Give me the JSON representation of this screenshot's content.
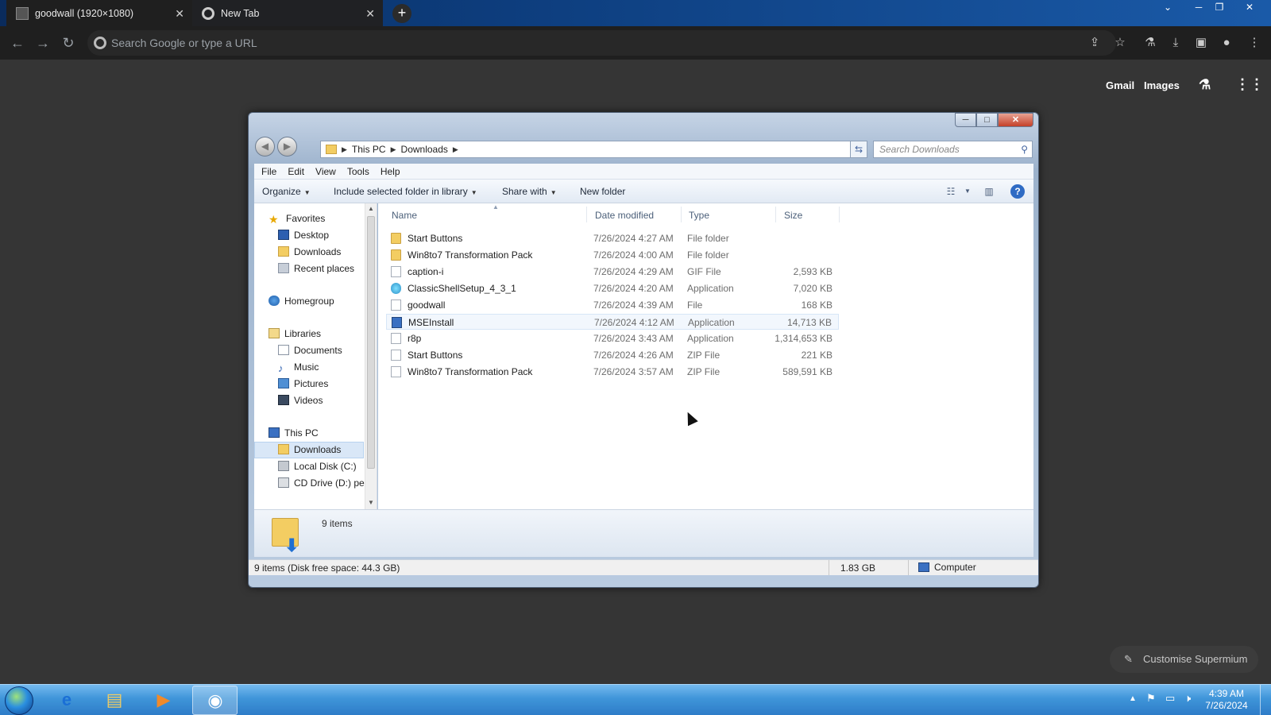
{
  "browser": {
    "tabs": [
      {
        "title": "goodwall (1920×1080)",
        "active": true
      },
      {
        "title": "New Tab",
        "active": false
      }
    ],
    "new_tab_label": "+",
    "omnibox_placeholder": "Search Google or type a URL",
    "ntp": {
      "gmail": "Gmail",
      "images": "Images",
      "customise": "Customise Supermium"
    }
  },
  "explorer": {
    "breadcrumb": [
      "This PC",
      "Downloads"
    ],
    "search_placeholder": "Search Downloads",
    "menu": [
      "File",
      "Edit",
      "View",
      "Tools",
      "Help"
    ],
    "commands": {
      "organize": "Organize",
      "include_library": "Include selected folder in library",
      "share_with": "Share with",
      "new_folder": "New folder"
    },
    "nav": {
      "favorites": "Favorites",
      "desktop": "Desktop",
      "downloads": "Downloads",
      "recent": "Recent places",
      "homegroup": "Homegroup",
      "libraries": "Libraries",
      "documents": "Documents",
      "music": "Music",
      "pictures": "Pictures",
      "videos": "Videos",
      "this_pc": "This PC",
      "pc_downloads": "Downloads",
      "local_disk": "Local Disk (C:)",
      "cd_drive": "CD Drive (D:) per"
    },
    "columns": {
      "name": "Name",
      "date": "Date modified",
      "type": "Type",
      "size": "Size"
    },
    "files": [
      {
        "name": "Start Buttons",
        "date": "7/26/2024 4:27 AM",
        "type": "File folder",
        "size": "",
        "icon": "folder-icon"
      },
      {
        "name": "Win8to7 Transformation Pack",
        "date": "7/26/2024 4:00 AM",
        "type": "File folder",
        "size": "",
        "icon": "folder-icon"
      },
      {
        "name": "caption-i",
        "date": "7/26/2024 4:29 AM",
        "type": "GIF File",
        "size": "2,593 KB",
        "icon": "file-icon"
      },
      {
        "name": "ClassicShellSetup_4_3_1",
        "date": "7/26/2024 4:20 AM",
        "type": "Application",
        "size": "7,020 KB",
        "icon": "app-icon"
      },
      {
        "name": "goodwall",
        "date": "7/26/2024 4:39 AM",
        "type": "File",
        "size": "168 KB",
        "icon": "file-icon"
      },
      {
        "name": "MSEInstall",
        "date": "7/26/2024 4:12 AM",
        "type": "Application",
        "size": "14,713 KB",
        "icon": "installer-icon"
      },
      {
        "name": "r8p",
        "date": "7/26/2024 3:43 AM",
        "type": "Application",
        "size": "1,314,653 KB",
        "icon": "file-icon"
      },
      {
        "name": "Start Buttons",
        "date": "7/26/2024 4:26 AM",
        "type": "ZIP File",
        "size": "221 KB",
        "icon": "zip-icon"
      },
      {
        "name": "Win8to7 Transformation Pack",
        "date": "7/26/2024 3:57 AM",
        "type": "ZIP File",
        "size": "589,591 KB",
        "icon": "zip-icon"
      }
    ],
    "details_count": "9 items",
    "status": {
      "items": "9 items (Disk free space: 44.3 GB)",
      "size": "1.83 GB",
      "location": "Computer"
    }
  },
  "taskbar": {
    "clock_time": "4:39 AM",
    "clock_date": "7/26/2024"
  }
}
